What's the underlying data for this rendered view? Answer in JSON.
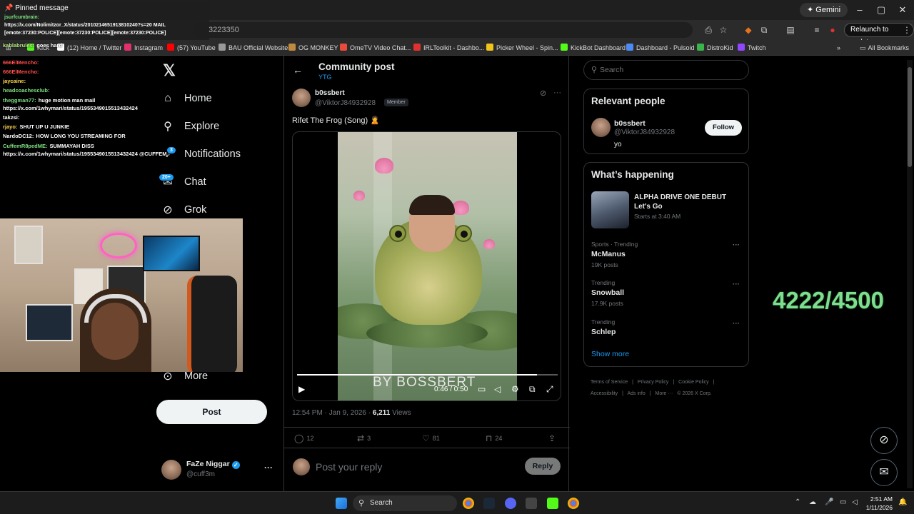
{
  "browser": {
    "gemini_label": "Gemini",
    "address_partial": "3223350",
    "relaunch_label": "Relaunch to update",
    "bookmarks": [
      {
        "label": "Kick",
        "color": "#53fc18"
      },
      {
        "label": "(12) Home / Twitter",
        "color": "#ffffff"
      },
      {
        "label": "Instagram",
        "color": "#e1306c"
      },
      {
        "label": "(57) YouTube",
        "color": "#ff0000"
      },
      {
        "label": "BAU Official Website",
        "color": "#999999"
      },
      {
        "label": "OG MONKEY",
        "color": "#c08a3e"
      },
      {
        "label": "OmeTV Video Chat...",
        "color": "#e84b3c"
      },
      {
        "label": "IRLToolkit - Dashbo...",
        "color": "#e03131"
      },
      {
        "label": "Picker Wheel - Spin...",
        "color": "#f0c419"
      },
      {
        "label": "KickBot Dashboard",
        "color": "#53fc18"
      },
      {
        "label": "Dashboard - Pulsoid",
        "color": "#4c8bf5"
      },
      {
        "label": "DistroKid",
        "color": "#39b54a"
      },
      {
        "label": "Twitch",
        "color": "#9146ff"
      }
    ],
    "all_bookmarks": "All Bookmarks"
  },
  "stream_chat": {
    "pinned_title": "Pinned message",
    "pinned_user": "jsurfcumbrain:",
    "pinned_lines": [
      "https://x.com/Nolimitzor_X/status/2010214651913810240?s=20 MAIL",
      "[emote:37230:POLICE][emote:37230:POLICE][emote:37230:POLICE]"
    ],
    "lines": [
      {
        "user": "kablabrules:",
        "text": "goes hard",
        "color": "#b8e986"
      },
      {
        "user": "666ElMencho:",
        "text": "",
        "color": "#ff4d4d"
      },
      {
        "user": "666ElMencho:",
        "text": "",
        "color": "#ff4d4d"
      },
      {
        "user": "jaycaine:",
        "text": "",
        "color": "#ffd84d"
      },
      {
        "user": "headcoachesclub:",
        "text": "",
        "color": "#7ee081"
      },
      {
        "user": "theggman77:",
        "text": "huge motion man mail",
        "color": "#7ee081"
      },
      {
        "user": "",
        "text": "https://x.com/1whymari/status/1955349015513432424",
        "color": "#ffffff"
      },
      {
        "user": "takzsi:",
        "text": "",
        "color": "#ffffff"
      },
      {
        "user": "rjayo:",
        "text": "SHUT UP U JUNKIE",
        "color": "#ffd84d"
      },
      {
        "user": "NardoDC12:",
        "text": "HOW LONG YOU STREAMING FOR",
        "color": "#ffffff"
      },
      {
        "user": "CuffemR8pedME:",
        "text": "SUMMAYAH DISS",
        "color": "#7ee081"
      },
      {
        "user": "",
        "text": "https://x.com/1whymari/status/1955349015513432424 @CUFFEM",
        "color": "#ffffff"
      }
    ]
  },
  "nav": {
    "items": [
      {
        "label": "Home",
        "icon": "home-icon",
        "glyph": "⌂"
      },
      {
        "label": "Explore",
        "icon": "search-icon",
        "glyph": "⚲"
      },
      {
        "label": "Notifications",
        "icon": "bell-icon",
        "glyph": "🔔"
      },
      {
        "label": "Chat",
        "icon": "chat-icon",
        "glyph": "✉"
      },
      {
        "label": "Grok",
        "icon": "grok-icon",
        "glyph": "⊘"
      },
      {
        "label": "More",
        "icon": "more-circle-icon",
        "glyph": "⊙"
      }
    ],
    "notifications_badge": "3",
    "chat_badge": "20+",
    "post_label": "Post"
  },
  "account": {
    "name": "FaZe Niggar",
    "handle": "@cuff3m"
  },
  "post": {
    "header_title": "Community post",
    "header_sub": "YTG",
    "author_name": "b0ssbert",
    "author_handle": "@ViktorJ84932928",
    "member_label": "Member",
    "text": "Rifet The Frog (Song) 🙎",
    "video": {
      "watermark": "BY BOSSBERT",
      "time": "0:46 / 0:50",
      "progress": 0.92
    },
    "timestamp": "12:54 PM · Jan 9, 2026 · ",
    "views_count": "6,211",
    "views_label": " Views",
    "replies": "12",
    "reposts": "3",
    "likes": "81",
    "bookmarks": "24",
    "reply_placeholder": "Post your reply",
    "reply_button": "Reply"
  },
  "sidebar": {
    "search_placeholder": "Search",
    "relevant_title": "Relevant people",
    "relevant_person": {
      "name": "b0ssbert",
      "handle": "@ViktorJ84932928",
      "bio": "yo",
      "follow_label": "Follow"
    },
    "happening_title": "What’s happening",
    "event": {
      "title": "ALPHA DRIVE ONE DEBUT Let's Go",
      "subtitle": "Starts at 3:40 AM"
    },
    "trends": [
      {
        "category": "Sports · Trending",
        "name": "McManus",
        "posts": "19K posts"
      },
      {
        "category": "Trending",
        "name": "Snowball",
        "posts": "17.9K posts"
      },
      {
        "category": "Trending",
        "name": "Schlep",
        "posts": ""
      }
    ],
    "show_more": "Show more",
    "footer": [
      "Terms of Service",
      "|",
      "Privacy Policy",
      "|",
      "Cookie Policy",
      "|",
      "Accessibility",
      "|",
      "Ads info",
      "|",
      "More ···",
      "© 2026 X Corp."
    ]
  },
  "overlay_counter": "4222/4500",
  "taskbar": {
    "search_label": "Search",
    "time": "2:51 AM",
    "date": "1/11/2026"
  }
}
